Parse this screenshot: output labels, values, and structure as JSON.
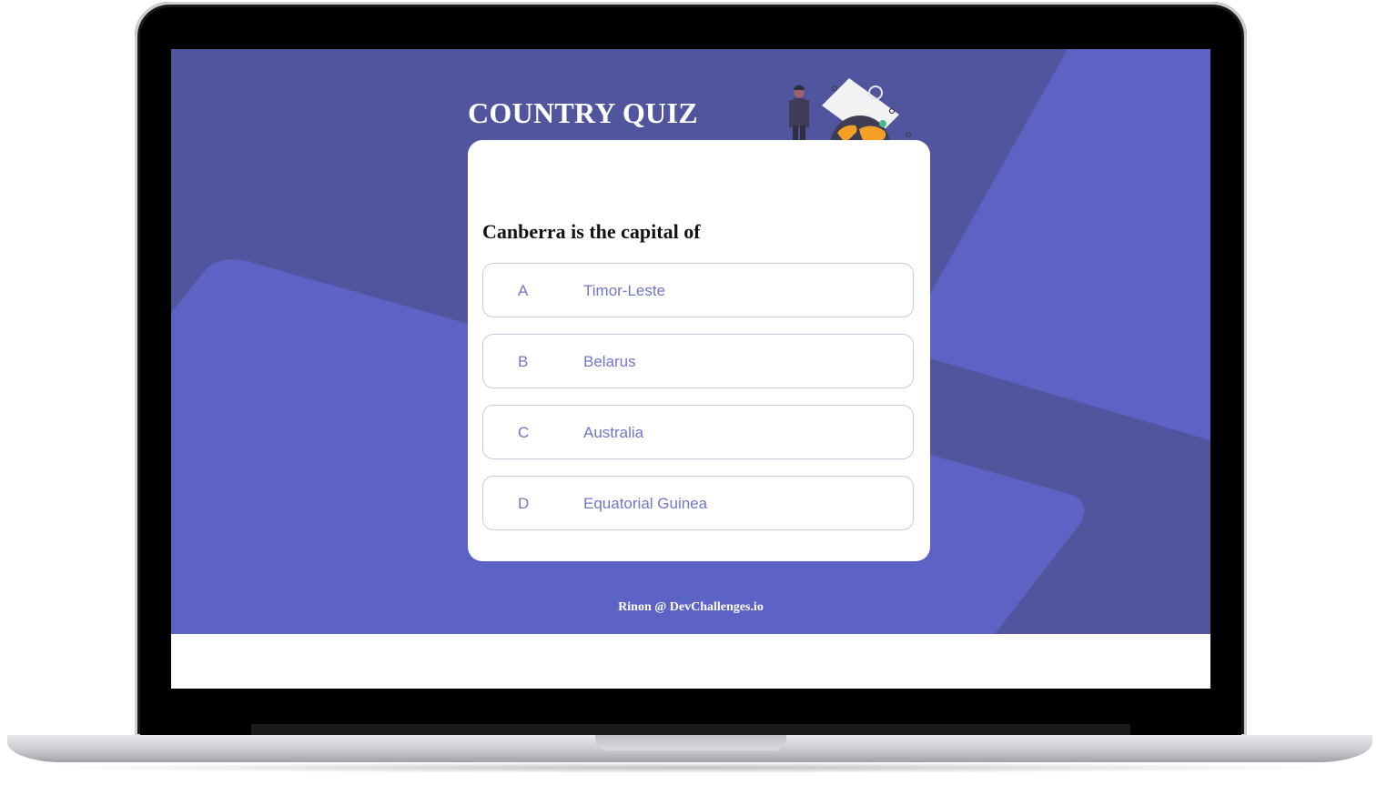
{
  "app": {
    "title": "COUNTRY QUIZ",
    "question": "Canberra is the capital of",
    "options": [
      {
        "letter": "A",
        "text": "Timor-Leste"
      },
      {
        "letter": "B",
        "text": "Belarus"
      },
      {
        "letter": "C",
        "text": "Australia"
      },
      {
        "letter": "D",
        "text": "Equatorial Guinea"
      }
    ],
    "footer": "Rinon @ DevChallenges.io"
  },
  "colors": {
    "background": "#5d63c5",
    "background_shape": "#51559e",
    "card": "#ffffff",
    "option_text": "#7176c9",
    "option_border": "#c9cae0",
    "globe": "#f4a026",
    "globe_sea": "#3f3d56"
  },
  "illustration": {
    "icon": "traveler-with-globe-icon"
  }
}
